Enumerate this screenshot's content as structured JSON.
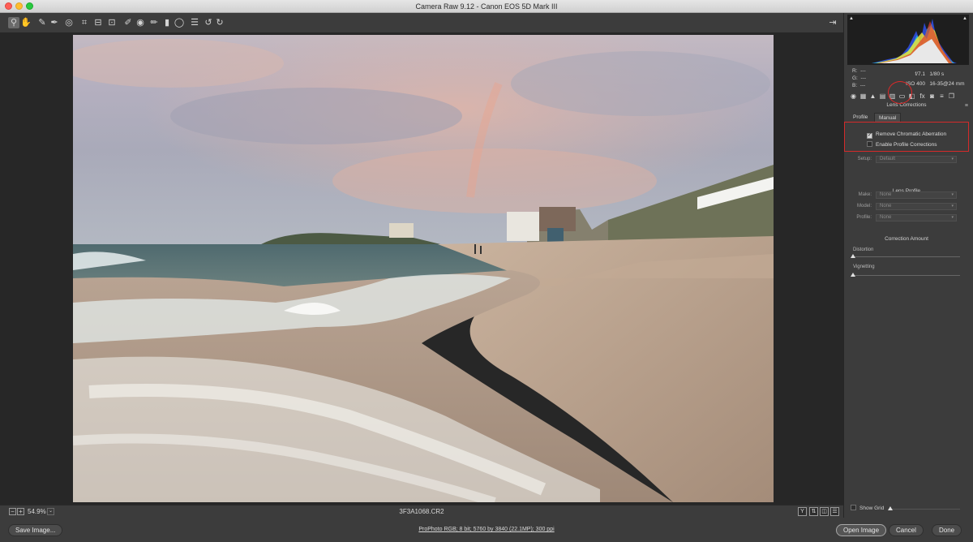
{
  "window": {
    "title": "Camera Raw 9.12  -  Canon EOS 5D Mark III"
  },
  "toolbar": {
    "tools": [
      {
        "name": "zoom-tool-icon",
        "glyph": "⚲"
      },
      {
        "name": "hand-tool-icon",
        "glyph": "✋"
      },
      {
        "name": "white-balance-tool-icon",
        "glyph": "✎"
      },
      {
        "name": "color-sampler-tool-icon",
        "glyph": "✒"
      },
      {
        "name": "targeted-adjustment-tool-icon",
        "glyph": "◎"
      },
      {
        "name": "crop-tool-icon",
        "glyph": "⌗"
      },
      {
        "name": "straighten-tool-icon",
        "glyph": "⊟"
      },
      {
        "name": "transform-tool-icon",
        "glyph": "⊡"
      },
      {
        "name": "spot-removal-tool-icon",
        "glyph": "✐"
      },
      {
        "name": "red-eye-tool-icon",
        "glyph": "◉"
      },
      {
        "name": "adjustment-brush-icon",
        "glyph": "✏"
      },
      {
        "name": "graduated-filter-icon",
        "glyph": "▮"
      },
      {
        "name": "radial-filter-icon",
        "glyph": "◯"
      },
      {
        "name": "preferences-icon",
        "glyph": "☰"
      },
      {
        "name": "rotate-left-icon",
        "glyph": "↺"
      },
      {
        "name": "rotate-right-icon",
        "glyph": "↻"
      }
    ],
    "exit_fullscreen_glyph": "⇥"
  },
  "status": {
    "zoom_out": "−",
    "zoom_in": "+",
    "zoom_value": "54.9%",
    "zoom_dropdown": "⌄",
    "filename": "3F3A1068.CR2",
    "view_y": "Y",
    "view_before_after": "⇅",
    "view_toggle": "◫",
    "view_settings": "☰"
  },
  "footer": {
    "save_image": "Save Image...",
    "workflow": "ProPhoto RGB; 8 bit; 5760 by 3840 (22.1MP); 300 ppi",
    "open_image": "Open Image",
    "cancel": "Cancel",
    "done": "Done"
  },
  "histogram": {
    "shadow_clip": "▲",
    "highlight_clip": "▲",
    "r_label": "R:",
    "r_value": "---",
    "g_label": "G:",
    "g_value": "---",
    "b_label": "B:",
    "b_value": "---",
    "aperture": "f/7.1",
    "shutter": "1/80 s",
    "iso": "ISO 400",
    "lens": "16-35@24 mm"
  },
  "panel_tabs": [
    {
      "name": "basic-tab-icon",
      "glyph": "◉"
    },
    {
      "name": "tone-curve-tab-icon",
      "glyph": "▦"
    },
    {
      "name": "detail-tab-icon",
      "glyph": "▲"
    },
    {
      "name": "hsl-tab-icon",
      "glyph": "▤"
    },
    {
      "name": "split-toning-tab-icon",
      "glyph": "▥"
    },
    {
      "name": "lens-corrections-tab-icon",
      "glyph": "▭"
    },
    {
      "name": "transform-tab-icon",
      "glyph": "◧"
    },
    {
      "name": "effects-tab-icon",
      "glyph": "fx"
    },
    {
      "name": "camera-calibration-tab-icon",
      "glyph": "◙"
    },
    {
      "name": "presets-tab-icon",
      "glyph": "≡"
    },
    {
      "name": "snapshots-tab-icon",
      "glyph": "❐"
    }
  ],
  "lens_panel": {
    "title": "Lens Corrections",
    "menu_glyph": "≡",
    "tab_profile": "Profile",
    "tab_manual": "Manual",
    "remove_ca_label": "Remove Chromatic Aberration",
    "remove_ca_checked": true,
    "enable_profile_label": "Enable Profile Corrections",
    "enable_profile_checked": false,
    "check_glyph": "✓",
    "setup_label": "Setup:",
    "setup_value": "Default",
    "lens_profile_title": "Lens Profile",
    "make_label": "Make:",
    "make_value": "None",
    "model_label": "Model:",
    "model_value": "None",
    "profile_label": "Profile:",
    "profile_value": "None",
    "dropdown_arrow": "▾",
    "correction_amount_title": "Correction Amount",
    "distortion_label": "Distortion",
    "vignetting_label": "Vignetting",
    "show_grid_label": "Show Grid"
  }
}
